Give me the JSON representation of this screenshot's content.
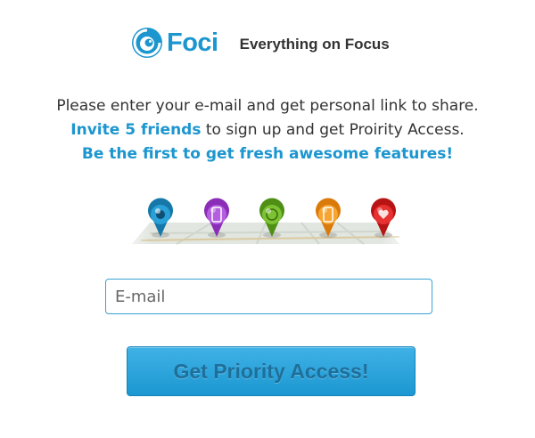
{
  "brand": {
    "name": "Foci",
    "tagline": "Everything on Focus",
    "color": "#1c96cf"
  },
  "intro": {
    "line1": "Please enter your e-mail and get personal link to share.",
    "line2_highlight": "Invite 5 friends",
    "line2_rest": " to sign up and get Proirity Access.",
    "line3": "Be the first to get fresh awesome features!"
  },
  "pins": [
    {
      "icon": "eye-icon",
      "color": "#1578a8"
    },
    {
      "icon": "phone-icon",
      "color": "#9b3fc7"
    },
    {
      "icon": "globe-icon",
      "color": "#5ea11e"
    },
    {
      "icon": "phone-icon",
      "color": "#f0921a"
    },
    {
      "icon": "heart-icon",
      "color": "#d61e1e"
    }
  ],
  "form": {
    "email_placeholder": "E-mail",
    "submit_label": "Get Priority Access!"
  }
}
